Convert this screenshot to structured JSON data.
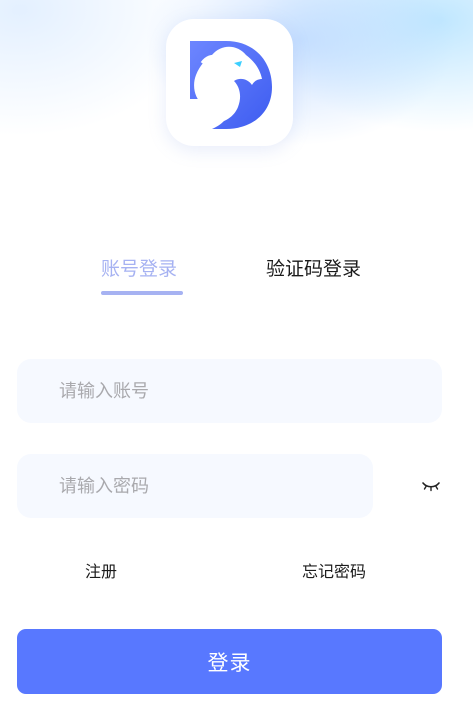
{
  "header": {
    "logo_icon": "dragon-d-logo-icon"
  },
  "tabs": [
    {
      "label": "账号登录",
      "active": true
    },
    {
      "label": "验证码登录",
      "active": false
    }
  ],
  "form": {
    "account_placeholder": "请输入账号",
    "account_value": "",
    "password_placeholder": "请输入密码",
    "password_value": "",
    "visibility_icon": "eye-closed-icon"
  },
  "links": {
    "register": "注册",
    "forgot_password": "忘记密码"
  },
  "login_button_label": "登录",
  "colors": {
    "primary": "#5878ff",
    "active_tab": "#a6b2f2",
    "input_bg": "#f6f9ff",
    "placeholder": "#a9a9ad",
    "text": "#1b1b1b"
  }
}
